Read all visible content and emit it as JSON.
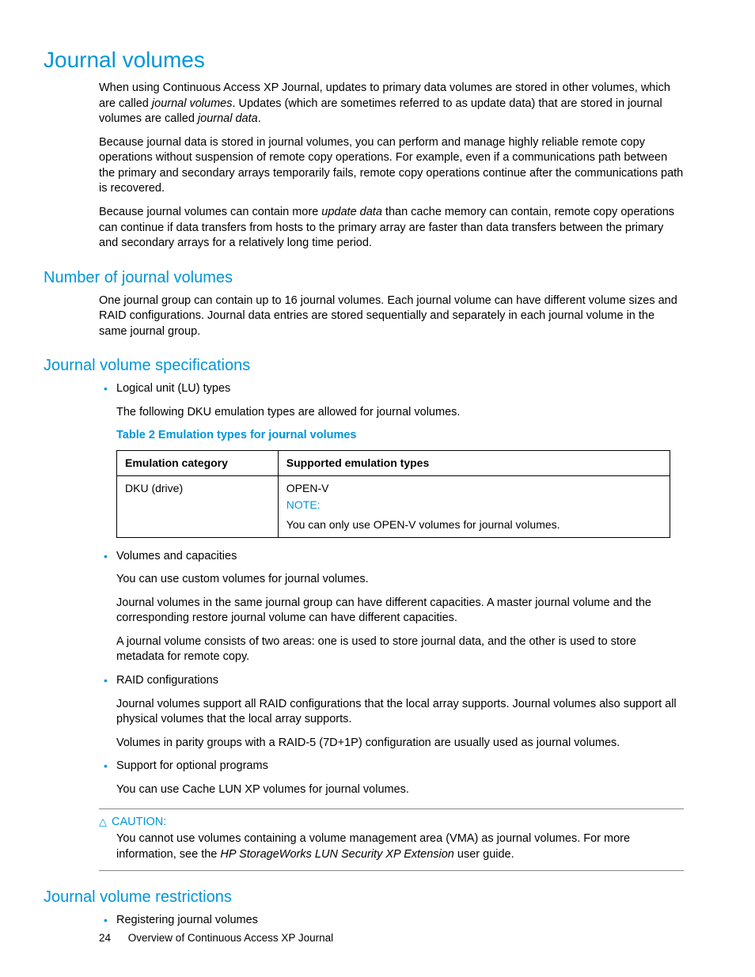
{
  "h1": "Journal volumes",
  "intro": {
    "p1a": "When using Continuous Access XP Journal, updates to primary data volumes are stored in other volumes, which are called ",
    "p1b": "journal volumes",
    "p1c": ". Updates (which are sometimes referred to as update data) that are stored in journal volumes are called ",
    "p1d": "journal data",
    "p1e": ".",
    "p2": "Because journal data is stored in journal volumes, you can perform and manage highly reliable remote copy operations without suspension of remote copy operations. For example, even if a communications path between the primary and secondary arrays temporarily fails, remote copy operations continue after the communications path is recovered.",
    "p3a": "Because journal volumes can contain more ",
    "p3b": "update data",
    "p3c": " than cache memory can contain, remote copy operations can continue if data transfers from hosts to the primary array are faster than data transfers between the primary and secondary arrays for a relatively long time period."
  },
  "sec_number": {
    "h2": "Number of journal volumes",
    "p1": "One journal group can contain up to 16 journal volumes. Each journal volume can have different volume sizes and RAID configurations. Journal data entries are stored sequentially and separately in each journal volume in the same journal group."
  },
  "sec_spec": {
    "h2": "Journal volume specifications",
    "li1": "Logical unit (LU) types",
    "li1_p1": "The following DKU emulation types are allowed for journal volumes.",
    "table_caption": "Table 2 Emulation types for journal volumes",
    "table": {
      "th1": "Emulation category",
      "th2": "Supported emulation types",
      "r1c1": "DKU (drive)",
      "r1c2_line1": "OPEN-V",
      "r1c2_note_label": "NOTE:",
      "r1c2_note_body": "You can only use OPEN-V volumes for journal volumes."
    },
    "li2": "Volumes and capacities",
    "li2_p1": "You can use custom volumes for journal volumes.",
    "li2_p2": "Journal volumes in the same journal group can have different capacities. A master journal volume and the corresponding restore journal volume can have different capacities.",
    "li2_p3": "A journal volume consists of two areas: one is used to store journal data, and the other is used to store metadata for remote copy.",
    "li3": "RAID configurations",
    "li3_p1": "Journal volumes support all RAID configurations that the local array supports. Journal volumes also support all physical volumes that the local array supports.",
    "li3_p2": "Volumes in parity groups with a RAID-5 (7D+1P) configuration are usually used as journal volumes.",
    "li4": "Support for optional programs",
    "li4_p1": "You can use Cache LUN XP volumes for journal volumes.",
    "caution_label": "CAUTION:",
    "caution_a": "You cannot use volumes containing a volume management area (VMA) as journal volumes. For more information, see the ",
    "caution_b": "HP StorageWorks LUN Security XP Extension",
    "caution_c": " user guide."
  },
  "sec_restrict": {
    "h2": "Journal volume restrictions",
    "li1": "Registering journal volumes"
  },
  "footer": {
    "page": "24",
    "title": "Overview of Continuous Access XP Journal"
  }
}
